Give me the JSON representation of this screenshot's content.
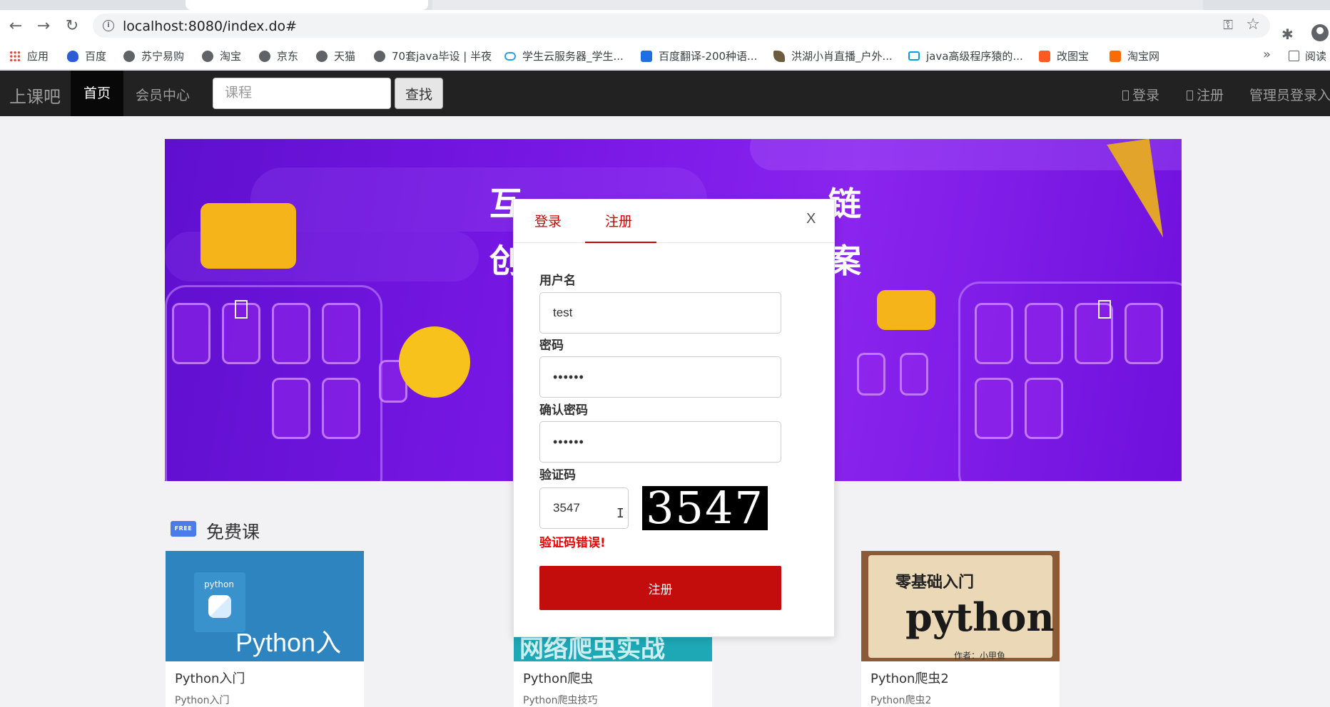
{
  "browser": {
    "url": "localhost:8080/index.do#",
    "bookmarks": [
      "应用",
      "百度",
      "苏宁易购",
      "淘宝",
      "京东",
      "天猫",
      "70套java毕设 | 半夜",
      "学生云服务器_学生...",
      "百度翻译-200种语...",
      "洪湖小肖直播_户外...",
      "java高级程序猿的...",
      "改图宝",
      "淘宝网"
    ],
    "more": "»",
    "reading_list": "阅读"
  },
  "navbar": {
    "brand": "上课吧",
    "home": "首页",
    "member": "会员中心",
    "search_placeholder": "课程",
    "search_button": "查找",
    "login": "登录",
    "register": "注册",
    "admin": "管理员登录入口"
  },
  "banner": {
    "headline_left": "创",
    "headline_right": "案",
    "headline_top_left": "互",
    "headline_top_right": "链"
  },
  "free_courses": {
    "badge": "FREE",
    "title": "免费课",
    "cards": [
      {
        "thumb_text": "Python入门",
        "thumb_small": "python",
        "title": "Python入门",
        "desc": "Python入门"
      },
      {
        "thumb_text": "网络爬虫实战",
        "title": "Python爬虫",
        "desc": "Python爬虫技巧"
      },
      {
        "thumb_line1": "零基础入门",
        "thumb_line2": "python",
        "thumb_line3": "作者：小甲鱼",
        "title": "Python爬虫2",
        "desc": "Python爬虫2"
      }
    ]
  },
  "modal": {
    "tab_login": "登录",
    "tab_register": "注册",
    "close": "X",
    "username_label": "用户名",
    "username_value": "test",
    "password_label": "密码",
    "password_value": "••••••",
    "confirm_label": "确认密码",
    "confirm_value": "••••••",
    "captcha_label": "验证码",
    "captcha_value": "3547",
    "captcha_image_text": "3547",
    "error": "验证码错误!",
    "submit": "注册"
  },
  "colors": {
    "accent_red": "#c30d0d",
    "navbar_bg": "#222222",
    "banner_purple": "#7a18e6"
  }
}
